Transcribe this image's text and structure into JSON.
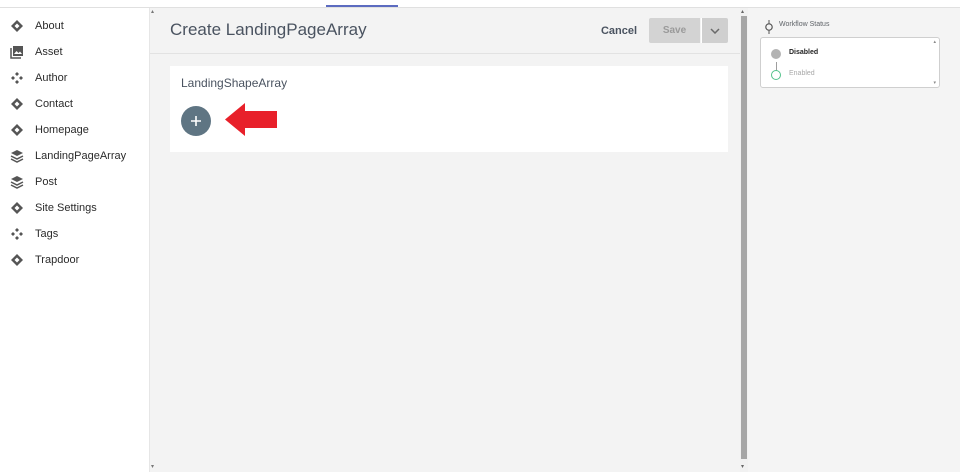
{
  "sidebar": {
    "items": [
      {
        "label": "About",
        "icon": "diamond-icon"
      },
      {
        "label": "Asset",
        "icon": "image-gallery-icon"
      },
      {
        "label": "Author",
        "icon": "component-icon"
      },
      {
        "label": "Contact",
        "icon": "diamond-icon"
      },
      {
        "label": "Homepage",
        "icon": "diamond-icon"
      },
      {
        "label": "LandingPageArray",
        "icon": "layers-icon"
      },
      {
        "label": "Post",
        "icon": "layers-icon"
      },
      {
        "label": "Site Settings",
        "icon": "diamond-icon"
      },
      {
        "label": "Tags",
        "icon": "component-icon"
      },
      {
        "label": "Trapdoor",
        "icon": "diamond-icon"
      }
    ]
  },
  "header": {
    "title": "Create LandingPageArray",
    "cancel_label": "Cancel",
    "save_label": "Save"
  },
  "form": {
    "field_label": "LandingShapeArray",
    "add_icon": "plus-icon"
  },
  "workflow": {
    "title": "Workflow Status",
    "states": [
      {
        "label": "Disabled",
        "active": true
      },
      {
        "label": "Enabled",
        "active": false
      }
    ]
  },
  "colors": {
    "add_button": "#5f7583",
    "annotation_arrow": "#e8202a",
    "enabled_state": "#52c28a",
    "disabled_state": "#b3b3b3",
    "save_disabled": "#d3d3d3"
  }
}
